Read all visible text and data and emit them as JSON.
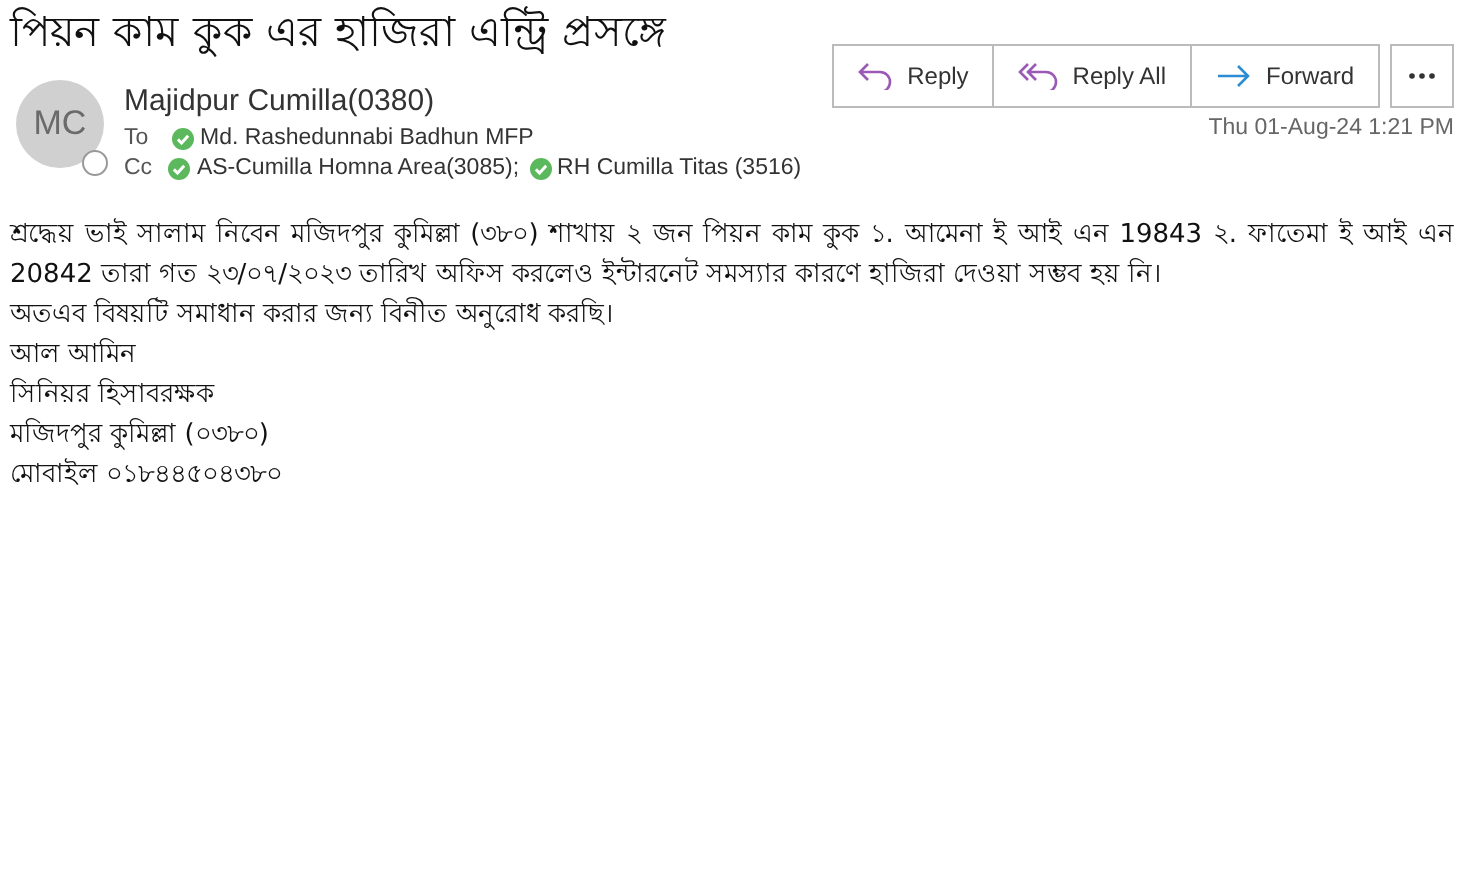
{
  "subject": "পিয়ন কাম কুক এর হাজিরা এন্ট্রি প্রসঙ্গে",
  "sender": {
    "initials": "MC",
    "name": "Majidpur Cumilla(0380)"
  },
  "recipients": [
    {
      "label": "To",
      "people": [
        "Md. Rashedunnabi Badhun MFP"
      ]
    },
    {
      "label": "Cc",
      "people": [
        "AS-Cumilla Homna Area(3085);",
        "RH Cumilla Titas (3516)"
      ]
    }
  ],
  "actions": [
    {
      "kind": "reply",
      "label": "Reply"
    },
    {
      "kind": "reply_all",
      "label": "Reply All"
    },
    {
      "kind": "forward",
      "label": "Forward"
    }
  ],
  "date": "Thu 01-Aug-24 1:21 PM",
  "body": [
    "শ্রদ্ধেয় ভাই সালাম নিবেন মজিদপুর কুমিল্লা (৩৮০) শাখায় ২ জন পিয়ন কাম কুক ১. আমেনা ই আই এন 19843 ২. ফাতেমা ই আই এন 20842 তারা গত ২৩/০৭/২০২৩ তারিখ অফিস করলেও ইন্টারনেট সমস্যার কারণে হাজিরা দেওয়া সম্ভব হয় নি।",
    "অতএব বিষয়টি সমাধান করার জন্য বিনীত অনুরোধ করছি।",
    "আল আমিন",
    "সিনিয়র হিসাবরক্ষক",
    "মজিদপুর কুমিল্লা (০৩৮০)",
    "মোবাইল ০১৮৪৪৫০৪৩৮০"
  ]
}
